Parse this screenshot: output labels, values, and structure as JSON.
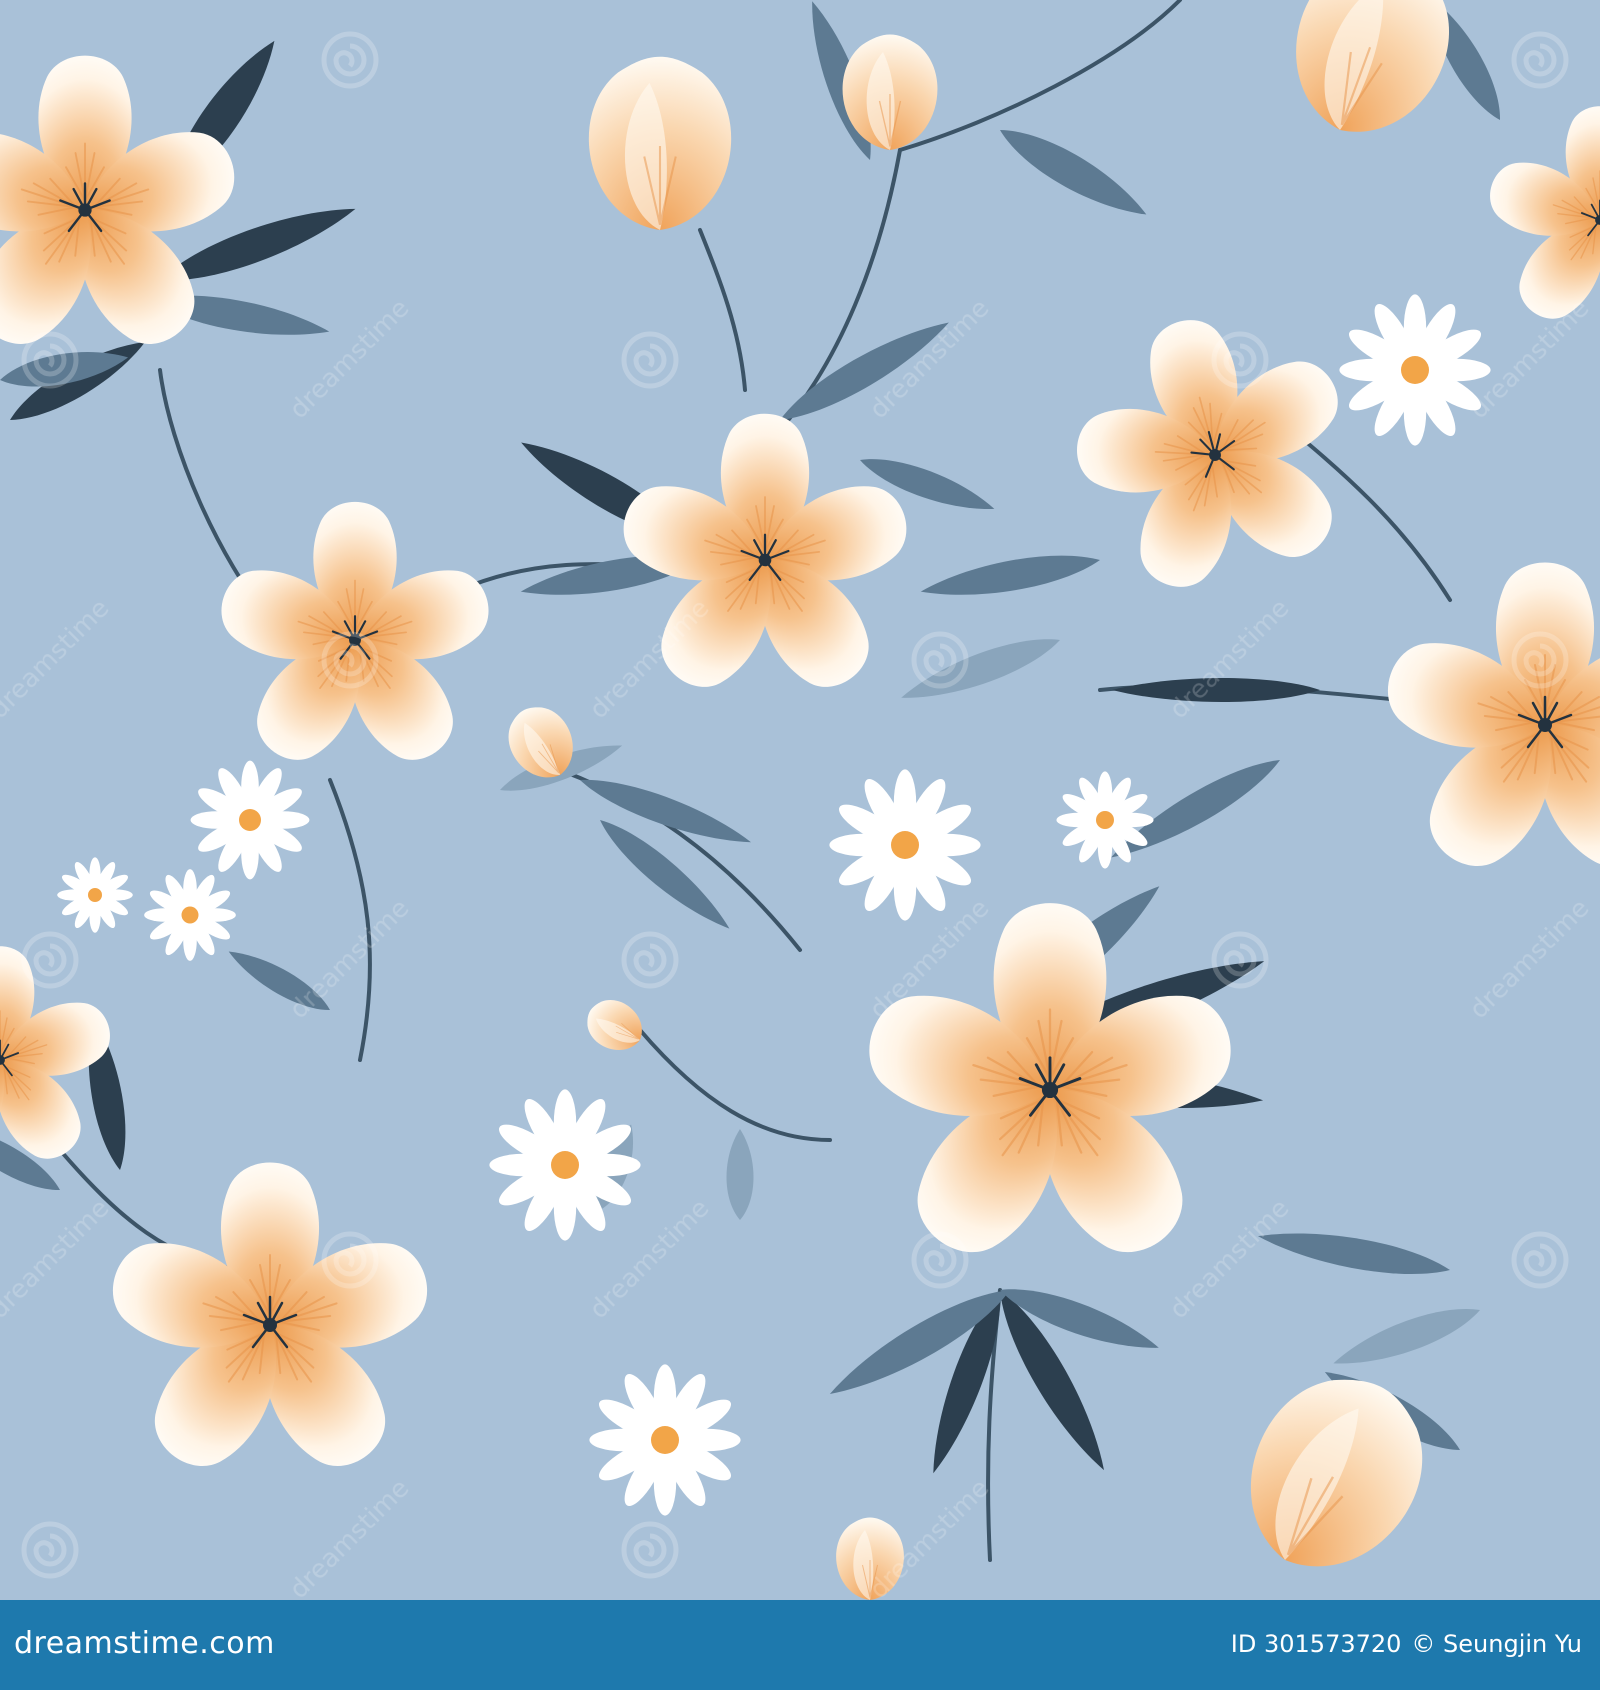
{
  "image": {
    "description_colors": {
      "background": "#a9c1d8",
      "petal_white": "#fffaf2",
      "petal_peach": "#f6bf86",
      "petal_orange": "#f0a35a",
      "leaf_dark": "#2c3f4f",
      "leaf_mid": "#5d7a92",
      "leaf_light": "#7f9bb3",
      "watermark": "#ffffff"
    },
    "watermark_text": "dreamstime"
  },
  "footer": {
    "brand": "dreamstime.com",
    "id_label": "ID 301573720",
    "copyright": "© Seungjin Yu",
    "bar_color": "#1e79ad"
  }
}
